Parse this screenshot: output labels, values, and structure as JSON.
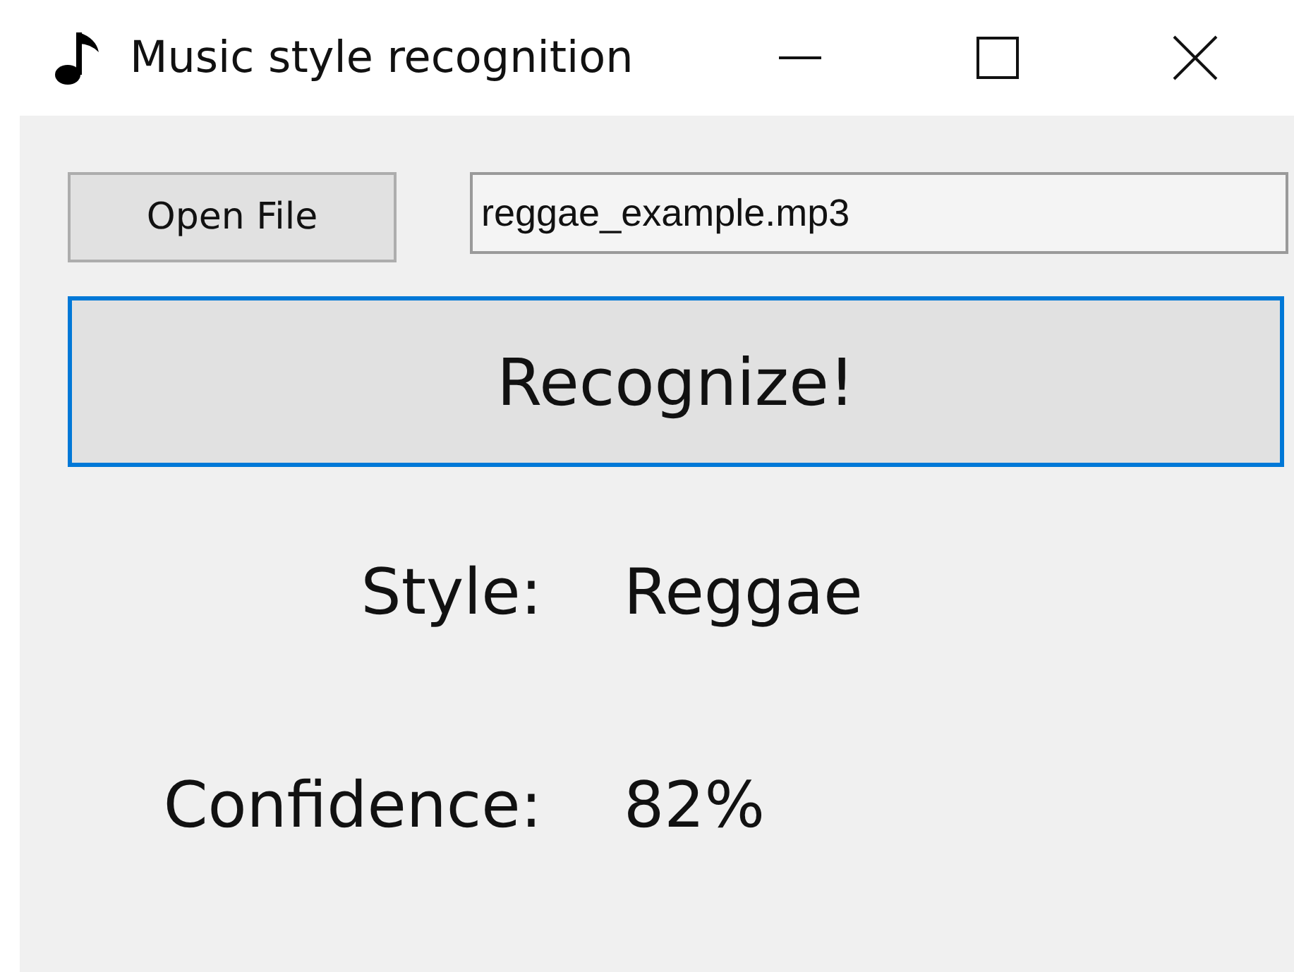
{
  "window": {
    "title": "Music style recognition"
  },
  "open_button": {
    "label": "Open File"
  },
  "file_field": {
    "value": "reggae_example.mp3"
  },
  "recognize_button": {
    "label": "Recognize!",
    "focused": true
  },
  "results": [
    {
      "label": "Style:",
      "value": "Reggae"
    },
    {
      "label": "Confidence:",
      "value": "82%"
    }
  ]
}
